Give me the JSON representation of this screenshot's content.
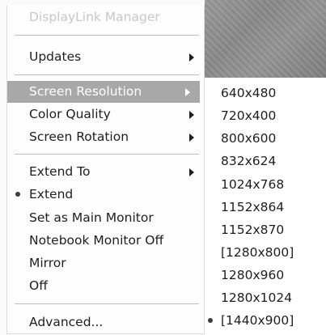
{
  "menu": {
    "title": "DisplayLink Manager",
    "items": [
      {
        "label": "Updates"
      },
      {
        "label": "Screen Resolution"
      },
      {
        "label": "Color Quality"
      },
      {
        "label": "Screen Rotation"
      },
      {
        "label": "Extend To"
      },
      {
        "label": "Extend"
      },
      {
        "label": "Set as Main Monitor"
      },
      {
        "label": "Notebook Monitor Off"
      },
      {
        "label": "Mirror"
      },
      {
        "label": "Off"
      },
      {
        "label": "Advanced..."
      }
    ]
  },
  "resolutions": {
    "items": [
      {
        "label": "640x480"
      },
      {
        "label": "720x400"
      },
      {
        "label": "800x600"
      },
      {
        "label": "832x624"
      },
      {
        "label": "1024x768"
      },
      {
        "label": "1152x864"
      },
      {
        "label": "1152x870"
      },
      {
        "label": "[1280x800]"
      },
      {
        "label": "1280x960"
      },
      {
        "label": "1280x1024"
      },
      {
        "label": "[1440x900]"
      }
    ]
  },
  "colors": {
    "highlight": "#a8a8a8",
    "disabled_text": "#c8c8c8"
  },
  "icons": [
    "submenu-arrow-icon",
    "radio-bullet-icon"
  ]
}
